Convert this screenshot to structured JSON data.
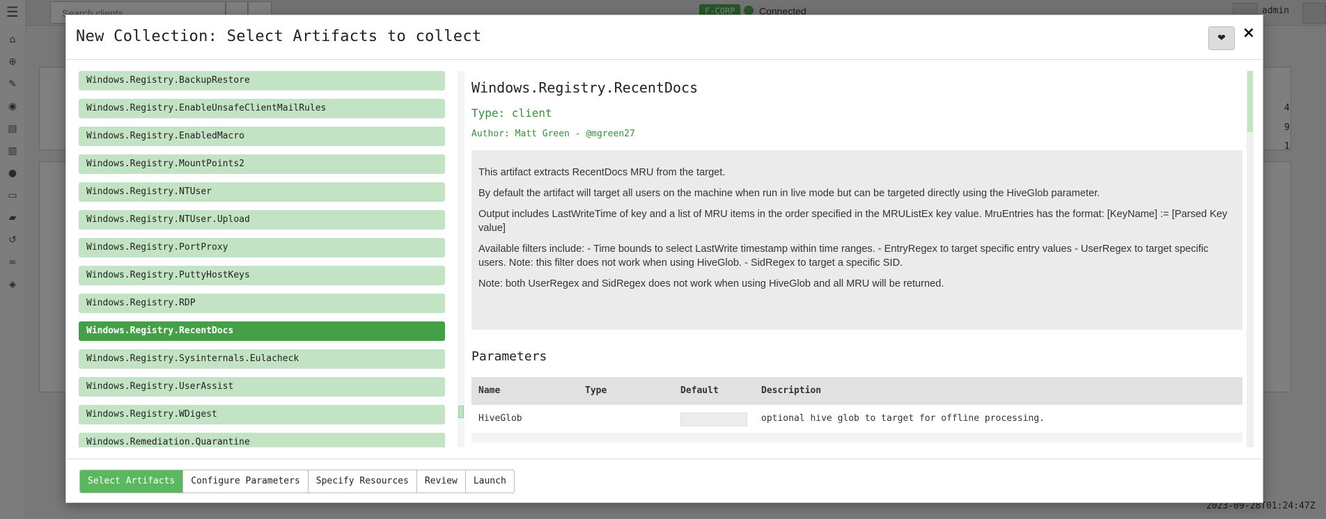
{
  "background": {
    "search_placeholder": "Search clients",
    "org_badge": "F-CORP",
    "connection_status": "Connected",
    "username": "admin",
    "timestamp": "2023-09-28T01:24:47Z",
    "counts": [
      "4",
      "9",
      "1"
    ]
  },
  "modal": {
    "title": "New Collection: Select Artifacts to collect",
    "close_label": "×",
    "favorite_icon": "heart-icon"
  },
  "artifacts": [
    {
      "name": "Windows.Registry.BackupRestore",
      "selected": false
    },
    {
      "name": "Windows.Registry.EnableUnsafeClientMailRules",
      "selected": false
    },
    {
      "name": "Windows.Registry.EnabledMacro",
      "selected": false
    },
    {
      "name": "Windows.Registry.MountPoints2",
      "selected": false
    },
    {
      "name": "Windows.Registry.NTUser",
      "selected": false
    },
    {
      "name": "Windows.Registry.NTUser.Upload",
      "selected": false
    },
    {
      "name": "Windows.Registry.PortProxy",
      "selected": false
    },
    {
      "name": "Windows.Registry.PuttyHostKeys",
      "selected": false
    },
    {
      "name": "Windows.Registry.RDP",
      "selected": false
    },
    {
      "name": "Windows.Registry.RecentDocs",
      "selected": true
    },
    {
      "name": "Windows.Registry.Sysinternals.Eulacheck",
      "selected": false
    },
    {
      "name": "Windows.Registry.UserAssist",
      "selected": false
    },
    {
      "name": "Windows.Registry.WDigest",
      "selected": false
    },
    {
      "name": "Windows.Remediation.Quarantine",
      "selected": false
    }
  ],
  "details": {
    "name": "Windows.Registry.RecentDocs",
    "type": "Type: client",
    "author": "Author: Matt Green - @mgreen27",
    "description": [
      "This artifact extracts RecentDocs MRU from the target.",
      "By default the artifact will target all users on the machine when run in live mode but can be targeted directly using the HiveGlob parameter.",
      "Output includes LastWriteTime of key and a list of MRU items in the order specified in the MRUListEx key value. MruEntries has the format: [KeyName] := [Parsed Key value]",
      "Available filters include: - Time bounds to select LastWrite timestamp within time ranges. - EntryRegex to target specific entry values - UserRegex to target specific users. Note: this filter does not work when using HiveGlob. - SidRegex to target a specific SID.",
      "Note: both UserRegex and SidRegex does not work when using HiveGlob and all MRU will be returned."
    ],
    "parameters_title": "Parameters",
    "parameters": {
      "headers": [
        "Name",
        "Type",
        "Default",
        "Description"
      ],
      "rows": [
        {
          "name": "HiveGlob",
          "type": "",
          "default": "",
          "description": "optional hive glob to target for offline processing."
        }
      ]
    }
  },
  "wizard": {
    "steps": [
      "Select Artifacts",
      "Configure Parameters",
      "Specify Resources",
      "Review",
      "Launch"
    ],
    "active": 0
  }
}
